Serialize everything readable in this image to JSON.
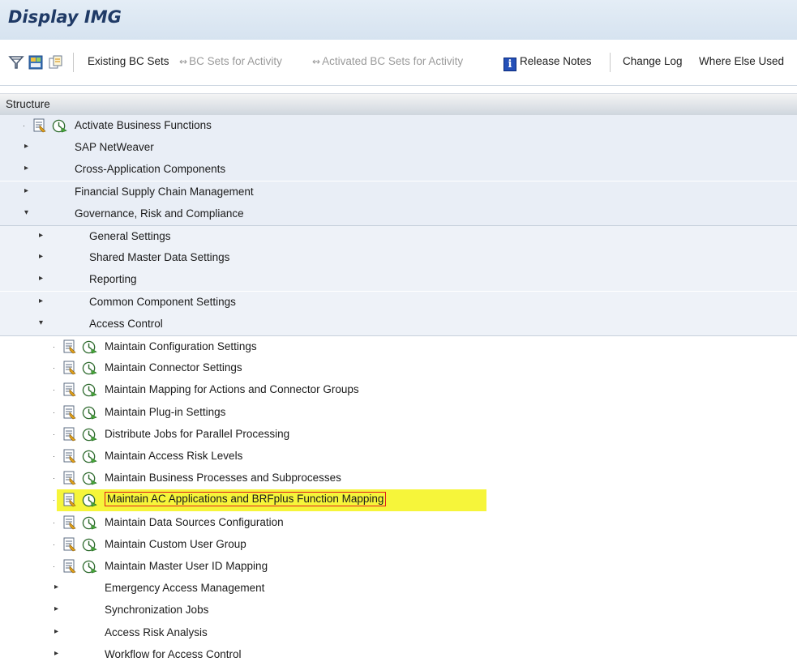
{
  "window": {
    "title": "Display IMG"
  },
  "toolbar": {
    "icons": [
      "filter-icon",
      "save-layout-icon",
      "copy-icon"
    ],
    "existing_bc_sets": "Existing BC Sets",
    "bc_sets_for_activity": "BC Sets for Activity",
    "activated_bc_sets_for_activity": "Activated BC Sets for Activity",
    "release_notes_icon": "i",
    "release_notes": "Release Notes",
    "change_log": "Change Log",
    "where_else_used": "Where Else Used"
  },
  "structure": {
    "header": "Structure",
    "items": [
      {
        "label": "Activate Business Functions",
        "level": 0,
        "type": "activity"
      },
      {
        "label": "SAP NetWeaver",
        "level": 0,
        "type": "node",
        "expanded": false
      },
      {
        "label": "Cross-Application Components",
        "level": 0,
        "type": "node",
        "expanded": false
      },
      {
        "label": "Financial Supply Chain Management",
        "level": 0,
        "type": "node",
        "expanded": false
      },
      {
        "label": "Governance, Risk and Compliance",
        "level": 0,
        "type": "node",
        "expanded": true
      },
      {
        "label": "General Settings",
        "level": 1,
        "type": "node",
        "expanded": false
      },
      {
        "label": "Shared Master Data Settings",
        "level": 1,
        "type": "node",
        "expanded": false
      },
      {
        "label": "Reporting",
        "level": 1,
        "type": "node",
        "expanded": false
      },
      {
        "label": "Common Component Settings",
        "level": 1,
        "type": "node",
        "expanded": false
      },
      {
        "label": "Access Control",
        "level": 1,
        "type": "node",
        "expanded": true
      },
      {
        "label": "Maintain Configuration Settings",
        "level": 2,
        "type": "activity"
      },
      {
        "label": "Maintain Connector Settings",
        "level": 2,
        "type": "activity"
      },
      {
        "label": "Maintain Mapping for Actions and Connector Groups",
        "level": 2,
        "type": "activity"
      },
      {
        "label": "Maintain Plug-in Settings",
        "level": 2,
        "type": "activity"
      },
      {
        "label": "Distribute Jobs for Parallel Processing",
        "level": 2,
        "type": "activity"
      },
      {
        "label": "Maintain Access Risk Levels",
        "level": 2,
        "type": "activity"
      },
      {
        "label": "Maintain Business Processes and Subprocesses",
        "level": 2,
        "type": "activity"
      },
      {
        "label": "Maintain AC Applications and BRFplus Function Mapping",
        "level": 2,
        "type": "activity",
        "selected": true
      },
      {
        "label": "Maintain Data Sources Configuration",
        "level": 2,
        "type": "activity"
      },
      {
        "label": "Maintain Custom User Group",
        "level": 2,
        "type": "activity"
      },
      {
        "label": "Maintain Master User ID Mapping",
        "level": 2,
        "type": "activity"
      },
      {
        "label": "Emergency Access Management",
        "level": 2,
        "type": "node",
        "expanded": false
      },
      {
        "label": "Synchronization Jobs",
        "level": 2,
        "type": "node",
        "expanded": false
      },
      {
        "label": "Access Risk Analysis",
        "level": 2,
        "type": "node",
        "expanded": false
      },
      {
        "label": "Workflow for Access Control",
        "level": 2,
        "type": "node",
        "expanded": false
      }
    ]
  },
  "colors": {
    "highlight": "#f6f53a",
    "selection_border": "#e21b1b",
    "title": "#1f3a66"
  }
}
